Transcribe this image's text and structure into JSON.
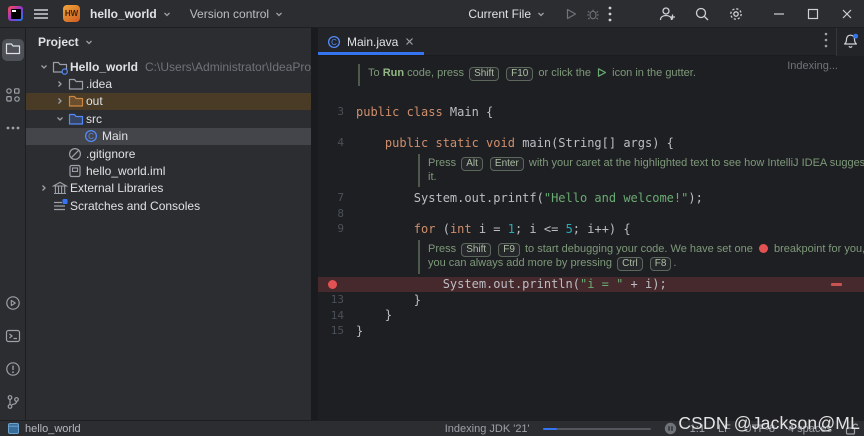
{
  "colors": {
    "accent": "#3574f0",
    "keyword": "#cf8e6d",
    "string": "#6aab73",
    "number": "#2aacb8",
    "breakpoint_line_bg": "#45292c",
    "breakpoint_dot": "#e35252",
    "selected_row_bg": "#43454a",
    "excluded_row_bg": "#4a3b26"
  },
  "title_bar": {
    "project_badge": "HW",
    "project_name": "hello_world",
    "vcs_button": "Version control",
    "run_config": "Current File"
  },
  "tool_strip": {
    "top": [
      "project-folder-tool",
      "structure-tool",
      "more-tools"
    ],
    "bottom": [
      "run-tool",
      "terminal-tool",
      "problems-tool",
      "version-control-tool"
    ],
    "active": "project-folder-tool"
  },
  "project_panel": {
    "title": "Project",
    "tree": [
      {
        "expander": "open",
        "icon": "project-folder",
        "label": "Hello_world",
        "bold": true,
        "suffix": "C:\\Users\\Administrator\\IdeaProjects\\Hello_w",
        "indent": 0
      },
      {
        "expander": "closed",
        "icon": "folder",
        "label": ".idea",
        "indent": 1
      },
      {
        "expander": "closed",
        "icon": "excluded-folder",
        "label": "out",
        "indent": 1,
        "state": "excluded"
      },
      {
        "expander": "open",
        "icon": "source-folder",
        "label": "src",
        "indent": 1
      },
      {
        "icon": "java-class",
        "label": "Main",
        "indent": 2,
        "state": "selected"
      },
      {
        "icon": "ignored-file",
        "label": ".gitignore",
        "indent": 1
      },
      {
        "icon": "module-file",
        "label": "hello_world.iml",
        "indent": 1
      },
      {
        "expander": "closed",
        "icon": "libraries",
        "label": "External Libraries",
        "indent": 0
      },
      {
        "icon": "scratches",
        "label": "Scratches and Consoles",
        "indent": 0
      }
    ]
  },
  "editor": {
    "tab": "Main.java",
    "indexing_hint": "Indexing...",
    "lines": [
      {
        "type": "hint",
        "indent": 1,
        "lines": [
          [
            {
              "k": "text",
              "v": "To "
            },
            {
              "k": "strong",
              "v": "Run"
            },
            {
              "k": "text",
              "v": " code, press "
            },
            {
              "k": "key",
              "v": "Shift"
            },
            {
              "k": "text",
              "v": " "
            },
            {
              "k": "key",
              "v": "F10"
            },
            {
              "k": "text",
              "v": " or click the "
            },
            {
              "k": "run-icon"
            },
            {
              "k": "text",
              "v": " icon in the gutter."
            }
          ]
        ]
      },
      {
        "type": "blank"
      },
      {
        "type": "code",
        "num": "3",
        "tokens": [
          {
            "c": "kw",
            "v": "public class "
          },
          {
            "c": "pl",
            "v": "Main {"
          }
        ]
      },
      {
        "type": "blank"
      },
      {
        "type": "code",
        "num": "4",
        "tokens": [
          {
            "c": "pl",
            "v": "    "
          },
          {
            "c": "kw",
            "v": "public static void "
          },
          {
            "c": "pl",
            "v": "main(String[] args) {"
          }
        ]
      },
      {
        "type": "hint",
        "indent": 3,
        "lines": [
          [
            {
              "k": "text",
              "v": "Press "
            },
            {
              "k": "key",
              "v": "Alt"
            },
            {
              "k": "text",
              "v": " "
            },
            {
              "k": "key",
              "v": "Enter"
            },
            {
              "k": "text",
              "v": " with your caret at the highlighted text to see how IntelliJ IDEA suggests fixing"
            }
          ],
          [
            {
              "k": "text",
              "v": "it."
            }
          ]
        ]
      },
      {
        "type": "code",
        "num": "7",
        "tokens": [
          {
            "c": "pl",
            "v": "        System.out.printf("
          },
          {
            "c": "str",
            "v": "\"Hello and welcome!\""
          },
          {
            "c": "pl",
            "v": ");"
          }
        ]
      },
      {
        "type": "code",
        "num": "8",
        "tokens": []
      },
      {
        "type": "code",
        "num": "9",
        "tokens": [
          {
            "c": "kw",
            "v": "        for "
          },
          {
            "c": "pl",
            "v": "("
          },
          {
            "c": "kw",
            "v": "int "
          },
          {
            "c": "pl",
            "v": "i = "
          },
          {
            "c": "num",
            "v": "1"
          },
          {
            "c": "pl",
            "v": "; i <= "
          },
          {
            "c": "num",
            "v": "5"
          },
          {
            "c": "pl",
            "v": "; i++) {"
          }
        ]
      },
      {
        "type": "hint",
        "indent": 3,
        "lines": [
          [
            {
              "k": "text",
              "v": "Press "
            },
            {
              "k": "key",
              "v": "Shift"
            },
            {
              "k": "text",
              "v": " "
            },
            {
              "k": "key",
              "v": "F9"
            },
            {
              "k": "text",
              "v": " to start debugging your code. We have set one "
            },
            {
              "k": "breakpoint-dot"
            },
            {
              "k": "text",
              "v": " breakpoint for you, but"
            }
          ],
          [
            {
              "k": "text",
              "v": "you can always add more by pressing "
            },
            {
              "k": "key",
              "v": "Ctrl"
            },
            {
              "k": "text",
              "v": " "
            },
            {
              "k": "key",
              "v": "F8"
            },
            {
              "k": "text",
              "v": "."
            }
          ]
        ]
      },
      {
        "type": "code",
        "num": "",
        "breakpoint": true,
        "tokens": [
          {
            "c": "pl",
            "v": "            System.out.println("
          },
          {
            "c": "str",
            "v": "\"i = \""
          },
          {
            "c": "pl",
            "v": " + i);"
          }
        ]
      },
      {
        "type": "code",
        "num": "13",
        "tokens": [
          {
            "c": "pl",
            "v": "        }"
          }
        ]
      },
      {
        "type": "code",
        "num": "14",
        "tokens": [
          {
            "c": "pl",
            "v": "    }"
          }
        ]
      },
      {
        "type": "code",
        "num": "15",
        "tokens": [
          {
            "c": "pl",
            "v": "}"
          }
        ]
      }
    ]
  },
  "status_bar": {
    "project": "hello_world",
    "indexing": "Indexing JDK '21'",
    "caret_position": "1:1",
    "line_separator": "LF",
    "encoding": "UTF-8",
    "indent_style": "4 spaces"
  },
  "watermark": "CSDN @Jackson@ML"
}
